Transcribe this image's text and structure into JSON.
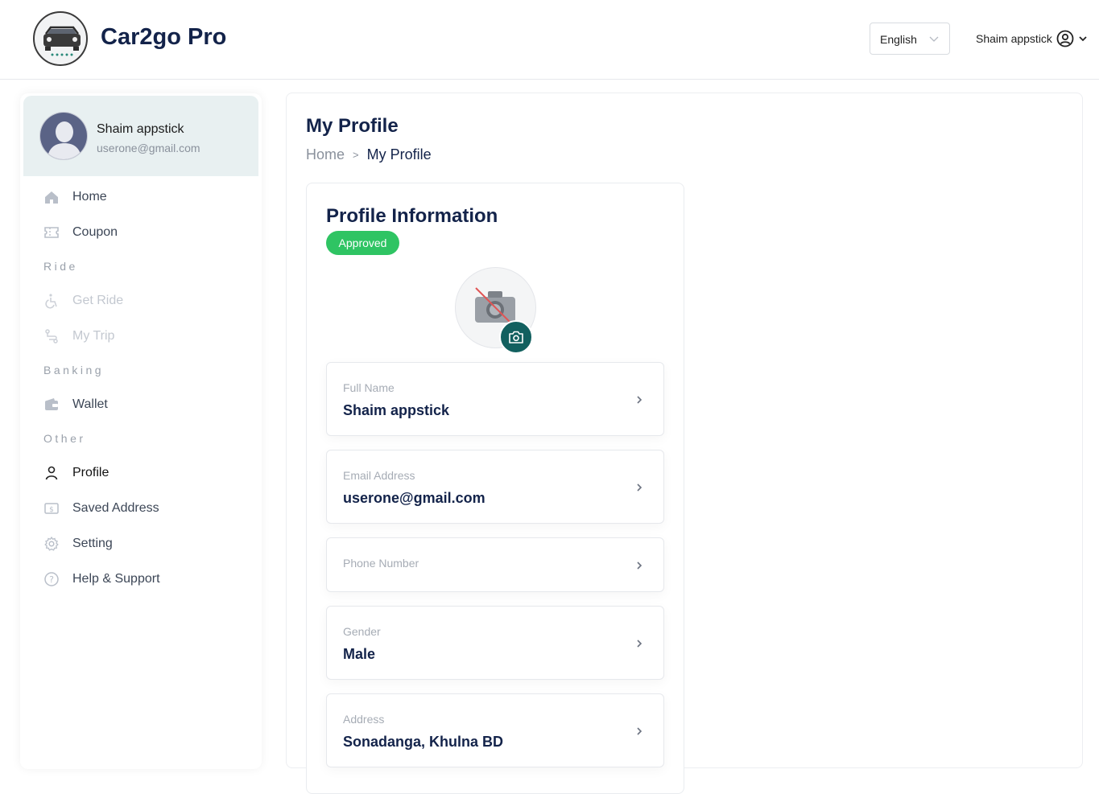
{
  "header": {
    "brand": "Car2go Pro",
    "language": "English",
    "user_name": "Shaim appstick"
  },
  "sidebar": {
    "user": {
      "name": "Shaim appstick",
      "email": "userone@gmail.com"
    },
    "items": [
      {
        "label": "Home",
        "icon": "home-icon"
      },
      {
        "label": "Coupon",
        "icon": "ticket-icon"
      },
      {
        "label": "Get Ride",
        "icon": "accessibility-icon"
      },
      {
        "label": "My Trip",
        "icon": "route-icon"
      },
      {
        "label": "Wallet",
        "icon": "wallet-icon"
      },
      {
        "label": "Profile",
        "icon": "user-icon"
      },
      {
        "label": "Saved Address",
        "icon": "dollar-card-icon"
      },
      {
        "label": "Setting",
        "icon": "gear-icon"
      },
      {
        "label": "Help & Support",
        "icon": "help-circle-icon"
      }
    ],
    "sections": {
      "ride": "Ride",
      "banking": "Banking",
      "other": "Other"
    }
  },
  "main": {
    "title": "My Profile",
    "breadcrumb": {
      "home": "Home",
      "separator": ">",
      "current": "My Profile"
    },
    "panel": {
      "title": "Profile Information",
      "status": "Approved",
      "fields": [
        {
          "label": "Full Name",
          "value": "Shaim appstick"
        },
        {
          "label": "Email Address",
          "value": "userone@gmail.com"
        },
        {
          "label": "Phone Number",
          "value": ""
        },
        {
          "label": "Gender",
          "value": "Male"
        },
        {
          "label": "Address",
          "value": "Sonadanga, Khulna BD"
        }
      ]
    }
  },
  "colors": {
    "brand_text": "#13234a",
    "approved": "#2fc463",
    "camera_button": "#12605f",
    "usercard_bg": "#e8f0f1"
  }
}
